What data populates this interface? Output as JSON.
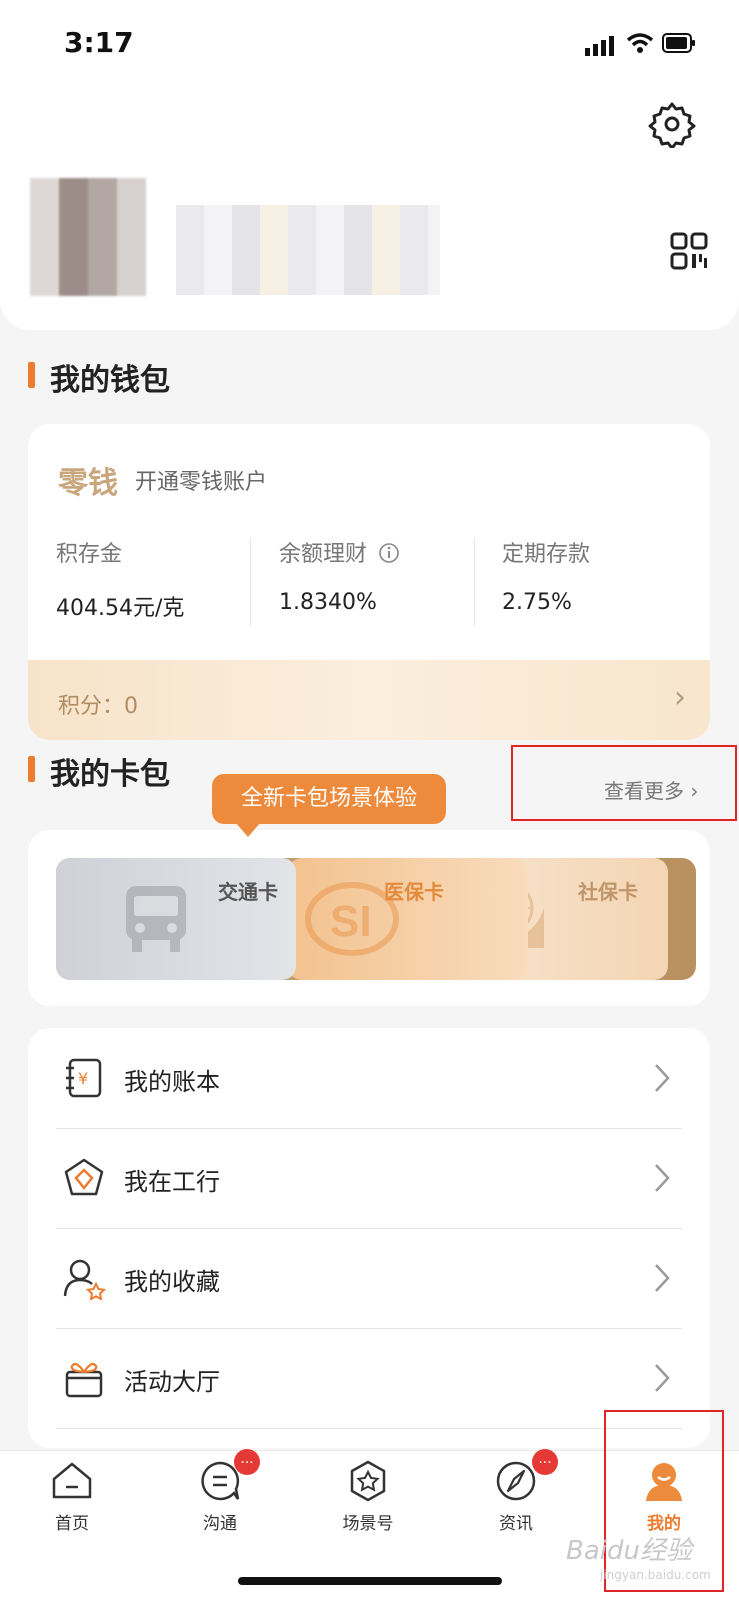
{
  "status": {
    "time": "3:17"
  },
  "wallet": {
    "title": "我的钱包",
    "change_label": "零钱",
    "change_sub": "开通零钱账户",
    "stats": [
      {
        "label": "积存金",
        "value": "404.54元/克"
      },
      {
        "label": "余额理财",
        "value": "1.8340%"
      },
      {
        "label": "定期存款",
        "value": "2.75%"
      }
    ],
    "points": "积分：0"
  },
  "cardpack": {
    "title": "我的卡包",
    "more": "查看更多",
    "tooltip": "全新卡包场景体验",
    "cards": [
      {
        "label": "交通卡",
        "color": "#c7c9ce"
      },
      {
        "label": "医保卡",
        "color": "#f4c79a"
      },
      {
        "label": "社保卡",
        "color": "#f6dcc0"
      }
    ]
  },
  "menu": [
    {
      "label": "我的账本",
      "icon": "ledger-icon"
    },
    {
      "label": "我在工行",
      "icon": "diamond-icon"
    },
    {
      "label": "我的收藏",
      "icon": "user-star-icon"
    },
    {
      "label": "活动大厅",
      "icon": "gift-icon"
    }
  ],
  "tabs": [
    {
      "label": "首页",
      "icon": "home-icon"
    },
    {
      "label": "沟通",
      "icon": "chat-icon",
      "badge": "..."
    },
    {
      "label": "场景号",
      "icon": "scene-star-icon"
    },
    {
      "label": "资讯",
      "icon": "compass-icon",
      "badge": "..."
    },
    {
      "label": "我的",
      "icon": "profile-icon",
      "active": true
    }
  ],
  "watermark": {
    "brand": "Baidu经验",
    "sub": "jingyan.baidu.com"
  },
  "colors": {
    "accent": "#ee7c2f",
    "gold": "#c9a77d",
    "highlight_box": "#e02525"
  }
}
